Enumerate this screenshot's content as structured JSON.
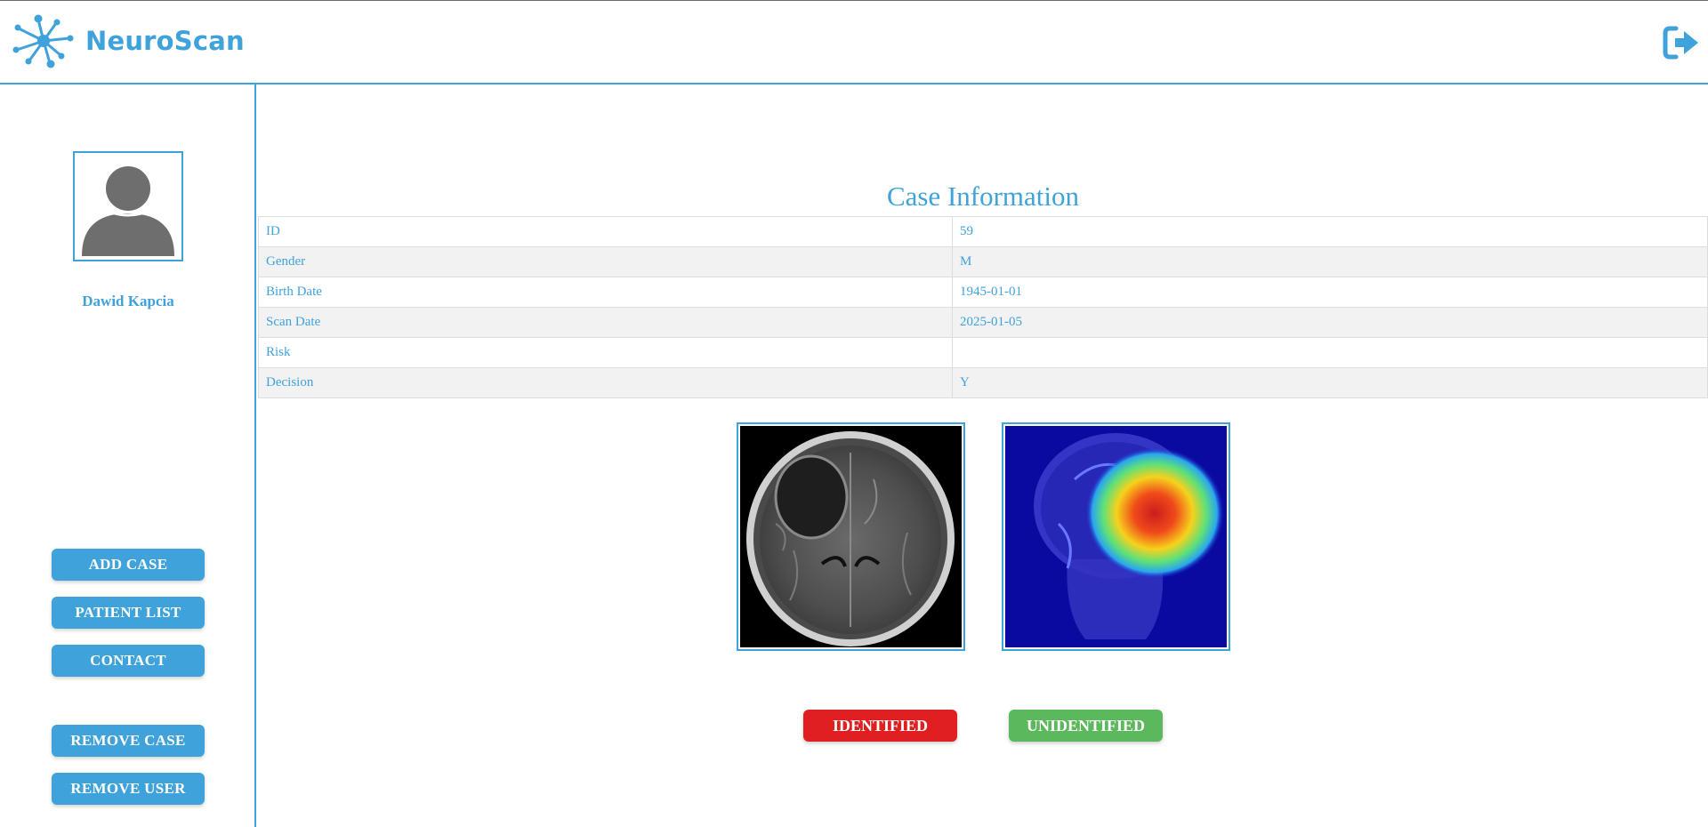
{
  "app": {
    "brand": "NeuroScan"
  },
  "header": {
    "logo_icon": "neuron-network-icon",
    "logout_icon": "sign-out-icon"
  },
  "sidebar": {
    "user_name": "Dawid Kapcia",
    "avatar_icon": "user-avatar-icon",
    "buttons": {
      "add_case": "ADD CASE",
      "patient_list": "PATIENT LIST",
      "contact": "CONTACT",
      "remove_case": "REMOVE CASE",
      "remove_user": "REMOVE USER"
    }
  },
  "case": {
    "title": "Case Information",
    "rows": [
      {
        "label": "ID",
        "value": "59"
      },
      {
        "label": "Gender",
        "value": "M"
      },
      {
        "label": "Birth Date",
        "value": "1945-01-01"
      },
      {
        "label": "Scan Date",
        "value": "2025-01-05"
      },
      {
        "label": "Risk",
        "value": ""
      },
      {
        "label": "Decision",
        "value": "Y"
      }
    ]
  },
  "images": {
    "mri": "axial-brain-mri-scan",
    "heatmap": "coronal-brain-mri-heatmap-overlay"
  },
  "decision": {
    "identified": "IDENTIFIED",
    "unidentified": "UNIDENTIFIED"
  },
  "colors": {
    "accent": "#3fa2db",
    "identified": "#e02020",
    "unidentified": "#5cb85c",
    "row_alt": "#f2f2f2"
  }
}
